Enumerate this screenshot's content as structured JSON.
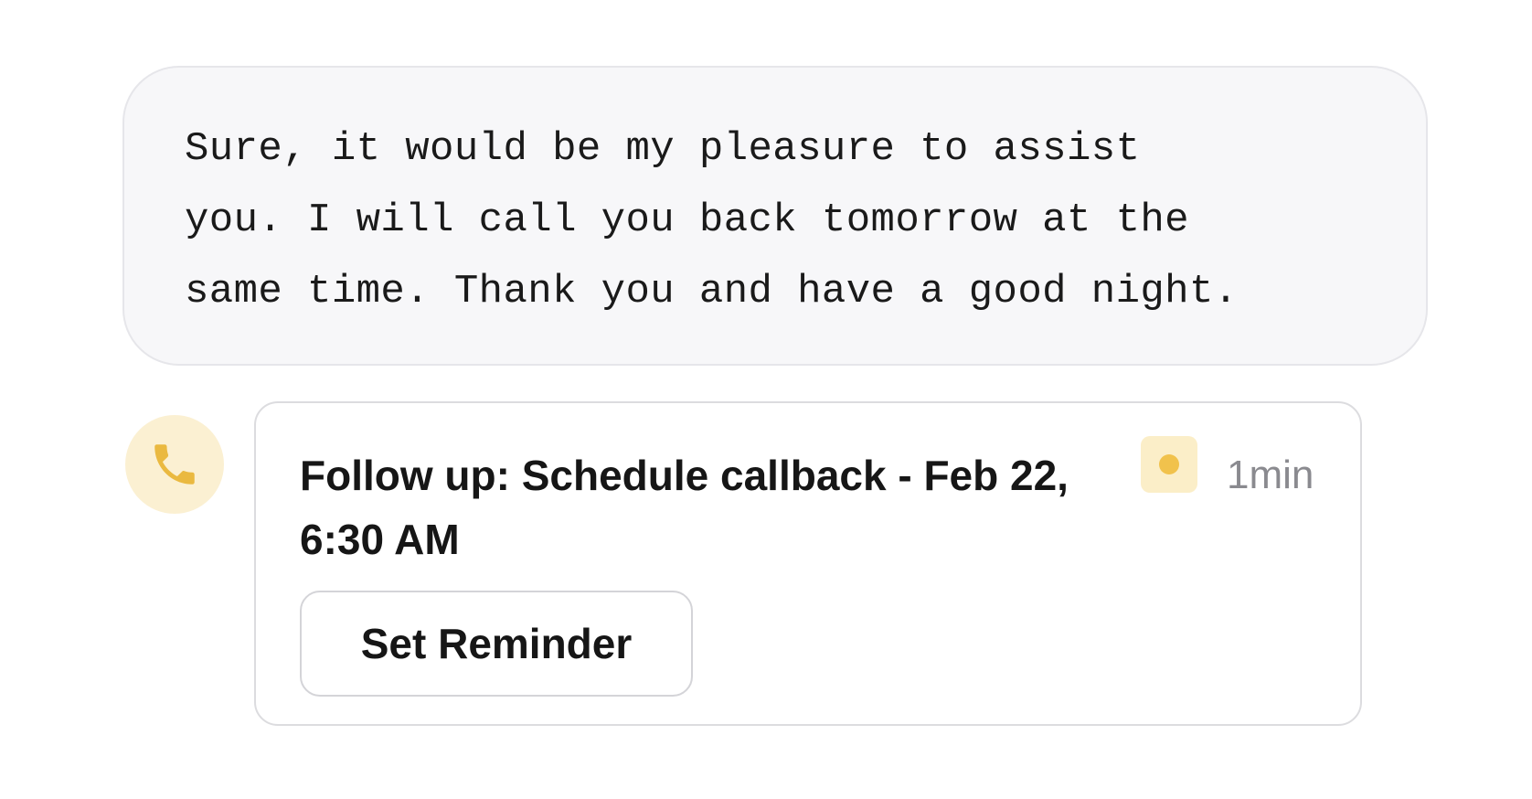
{
  "message": {
    "text": "Sure, it would be my pleasure to assist\nyou. I will call you back tomorrow at the\nsame time. Thank you and have a good night."
  },
  "activity": {
    "icon": "phone-icon",
    "title": "Follow up: Schedule callback - Feb 22, 6:30 AM",
    "status_icon": "status-dot-icon",
    "duration": "1min",
    "action_label": "Set Reminder"
  },
  "colors": {
    "accent": "#f1c24c",
    "accent_soft": "#fbf0d2",
    "bubble_bg": "#f7f7f9"
  }
}
